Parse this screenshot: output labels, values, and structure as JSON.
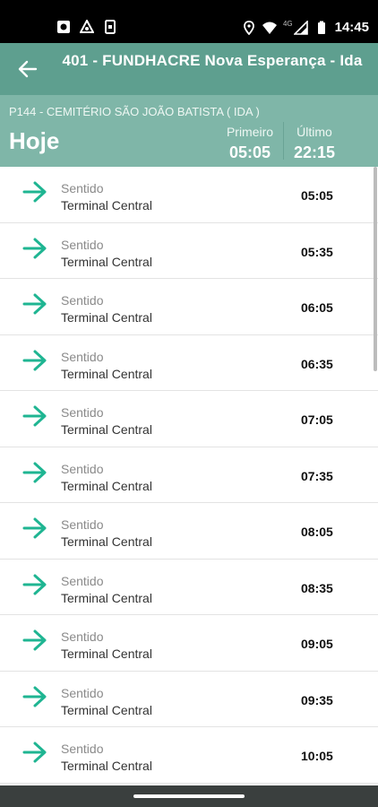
{
  "status_bar": {
    "time": "14:45",
    "network": "4G",
    "left_icons": [
      "notification-icon-1",
      "notification-icon-2",
      "notification-icon-3"
    ],
    "right_icons": [
      "location-icon",
      "wifi-icon",
      "signal-icon",
      "battery-icon"
    ]
  },
  "app_bar": {
    "title": "401 - FUNDHACRE Nova Esperança - Ida",
    "background": "#5e9f8f"
  },
  "stop": {
    "name": "P144 - CEMITÉRIO SÃO JOÃO BATISTA ( IDA )",
    "day": "Hoje",
    "first_label": "Primeiro",
    "first_time": "05:05",
    "last_label": "Último",
    "last_time": "22:15",
    "background": "#7fb6a8"
  },
  "schedule": [
    {
      "label": "Sentido",
      "direction": "Terminal Central",
      "time": "05:05"
    },
    {
      "label": "Sentido",
      "direction": "Terminal Central",
      "time": "05:35"
    },
    {
      "label": "Sentido",
      "direction": "Terminal Central",
      "time": "06:05"
    },
    {
      "label": "Sentido",
      "direction": "Terminal Central",
      "time": "06:35"
    },
    {
      "label": "Sentido",
      "direction": "Terminal Central",
      "time": "07:05"
    },
    {
      "label": "Sentido",
      "direction": "Terminal Central",
      "time": "07:35"
    },
    {
      "label": "Sentido",
      "direction": "Terminal Central",
      "time": "08:05"
    },
    {
      "label": "Sentido",
      "direction": "Terminal Central",
      "time": "08:35"
    },
    {
      "label": "Sentido",
      "direction": "Terminal Central",
      "time": "09:05"
    },
    {
      "label": "Sentido",
      "direction": "Terminal Central",
      "time": "09:35"
    },
    {
      "label": "Sentido",
      "direction": "Terminal Central",
      "time": "10:05"
    }
  ],
  "accent_color": "#1fb592"
}
